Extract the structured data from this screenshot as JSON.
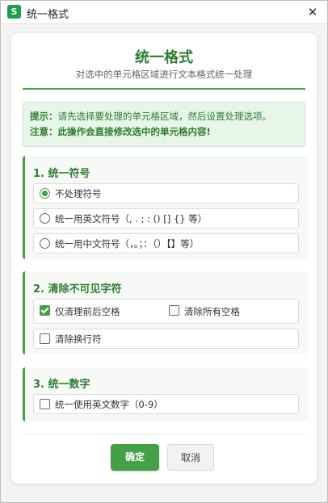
{
  "window": {
    "app_icon_letter": "S",
    "title": "统一格式",
    "close_glyph": "✕"
  },
  "header": {
    "title": "统一格式",
    "subtitle": "对选中的单元格区域进行文本格式统一处理"
  },
  "tip": {
    "label1": "提示：",
    "text1": "请先选择要处理的单元格区域，然后设置处理选项。",
    "label2": "注意：",
    "text2": "此操作会直接修改选中的单元格内容!"
  },
  "sections": [
    {
      "title": "1. 统一符号",
      "options": [
        {
          "label": "不处理符号",
          "checked": true
        },
        {
          "label": "统一用英文符号（, . ; : () [] {} 等）",
          "checked": false
        },
        {
          "label": "统一用中文符号（，。；：（）【】等）",
          "checked": false
        }
      ]
    },
    {
      "title": "2. 清除不可见字符",
      "options": [
        {
          "label": "仅清理前后空格",
          "checked": true
        },
        {
          "label": "清除所有空格",
          "checked": false
        },
        {
          "label": "清除换行符",
          "checked": false
        }
      ]
    },
    {
      "title": "3. 统一数字",
      "options": [
        {
          "label": "统一使用英文数字（0-9）",
          "checked": false
        }
      ]
    }
  ],
  "buttons": {
    "ok": "确定",
    "cancel": "取消"
  },
  "colors": {
    "accent": "#43a047",
    "heading": "#2e7d32",
    "tip_bg": "#e8f5e9",
    "app_icon": "#1e9e4a"
  },
  "icons": {
    "app": "spreadsheet-app-icon",
    "close": "close-icon"
  }
}
